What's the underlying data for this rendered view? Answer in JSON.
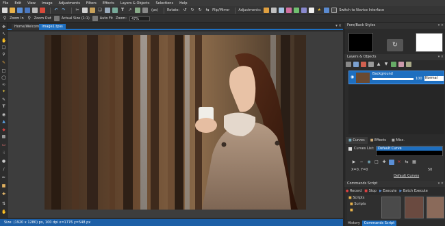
{
  "menu": [
    "File",
    "Edit",
    "View",
    "Image",
    "Adjustments",
    "Filters",
    "Effects",
    "Layers & Objects",
    "Selections",
    "Help"
  ],
  "toolbar": {
    "zoom_value": "(px)",
    "rotate_label": "Rotate:",
    "flip_label": "Flip/Mirror",
    "adjustments_label": "Adjustments:",
    "novice_label": "Switch to Novice Interface"
  },
  "toolbar2": {
    "zoom_in": "Zoom In",
    "zoom_out": "Zoom Out",
    "actual_size": "Actual Size (1:1)",
    "auto_fit": "Auto Fit",
    "zoom_label": "Zoom:",
    "zoom_value": "47%"
  },
  "tabs": [
    "Home/Welcome",
    "Image1.tpss"
  ],
  "status": "Size: (1920 x 1280) px, 100 dpi    x=1776 y=548 px",
  "panels": {
    "fore_back": "Fore/Back Styles",
    "layers": "Layers & Objects",
    "layer_name": "Background",
    "opacity": "100",
    "blend": "Normal",
    "tab_curves": "Curves",
    "tab_effects": "Effects",
    "tab_misc": "Misc.",
    "curves_list_label": "Curves List:",
    "default_curve": "Default Curve",
    "xy": "X=0, Y=0",
    "default_curves": "Default Curves",
    "curves_num": "50",
    "commands": "Commands Script",
    "record": "Record",
    "stop": "Stop",
    "execute": "Execute",
    "batch": "Batch Execute",
    "scripts_tab": "Scripts",
    "folder1": "Scripts",
    "folder2": "",
    "bottom_tab1": "History",
    "bottom_tab2": "Commands Script"
  },
  "colors": {
    "accent": "#1e6fc0",
    "status_bar": "#1d5fa6"
  }
}
